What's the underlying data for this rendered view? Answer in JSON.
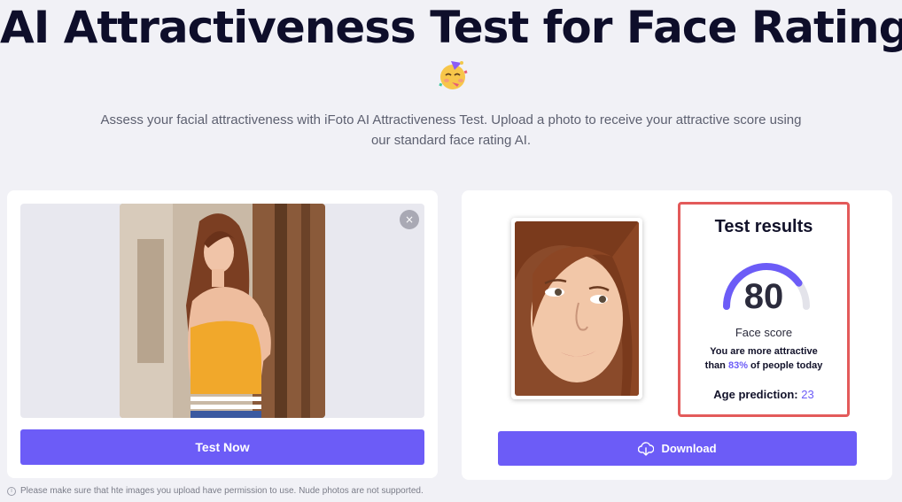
{
  "page": {
    "title": "AI Attractiveness Test for Face Rating",
    "emoji": "partying-face-emoji",
    "subtitle_line1": "Assess your facial attractiveness with iFoto AI Attractiveness Test. Upload a photo to receive your attractive score using",
    "subtitle_line2": "our standard face rating AI."
  },
  "upload": {
    "close_icon": "×",
    "test_button_label": "Test Now"
  },
  "results": {
    "title": "Test results",
    "score": "80",
    "score_fraction": 0.8,
    "score_label": "Face score",
    "attractive_line1": "You are more attractive",
    "attractive_prefix": "than ",
    "percentile": "83%",
    "attractive_suffix": " of people today",
    "age_label": "Age prediction:",
    "age_value": "23",
    "download_label": "Download"
  },
  "footer": {
    "note": "Please make sure that hte images you upload have permission to use. Nude photos are not supported."
  },
  "colors": {
    "accent": "#6c5cf7",
    "highlight_border": "#e35a5a",
    "gauge_track": "#e3e3ea",
    "background": "#f1f1f6"
  }
}
